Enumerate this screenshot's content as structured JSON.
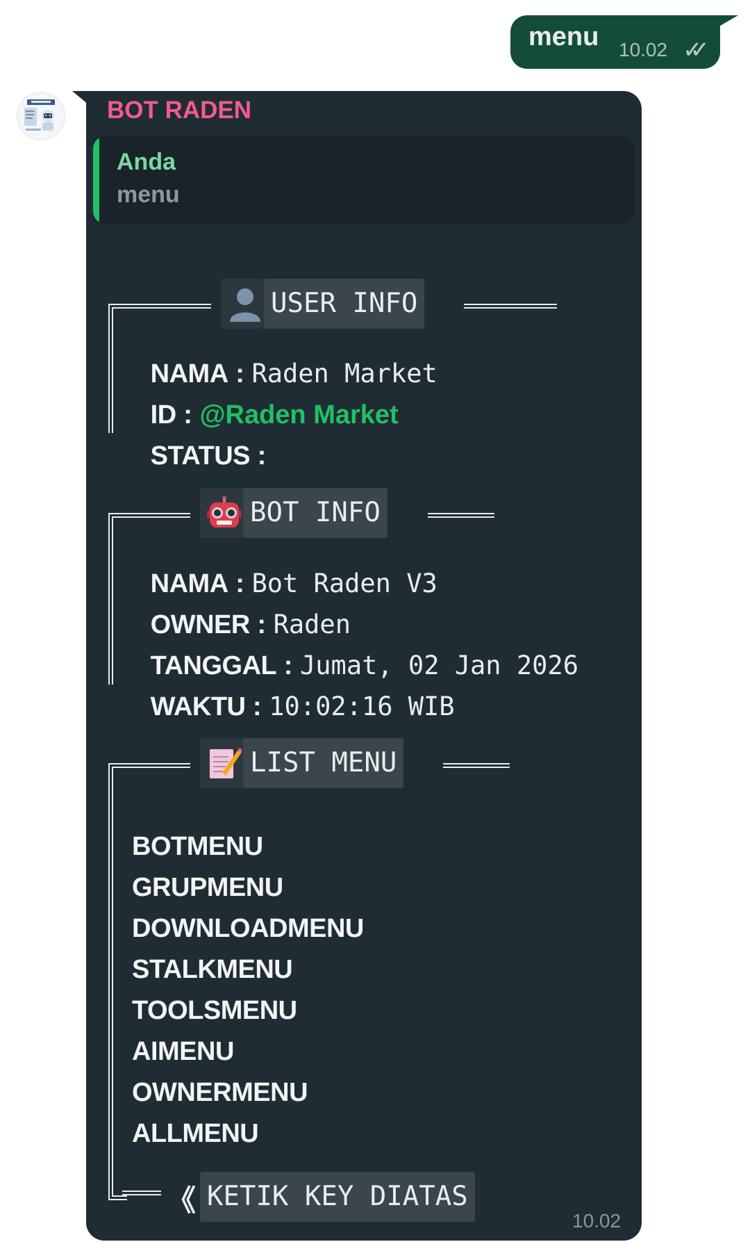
{
  "outgoing": {
    "text": "menu",
    "time": "10.02",
    "status_icon": "double-check-icon"
  },
  "incoming": {
    "sender": "BOT RADEN",
    "time": "10.02",
    "quote": {
      "author": "Anda",
      "text": "menu"
    },
    "user_info": {
      "header": "USER INFO",
      "icon": "user-silhouette-icon",
      "rows": [
        {
          "label": "NAMA",
          "value": "Raden Market"
        },
        {
          "label": "ID",
          "value": "@Raden Market"
        },
        {
          "label": "STATUS",
          "value": ""
        }
      ]
    },
    "bot_info": {
      "header": "BOT INFO",
      "icon": "robot-icon",
      "rows": [
        {
          "label": "NAMA",
          "value": "Bot Raden V3"
        },
        {
          "label": "OWNER",
          "value": "Raden"
        },
        {
          "label": "TANGGAL",
          "value": "Jumat, 02 Jan 2026"
        },
        {
          "label": "WAKTU",
          "value": "10:02:16 WIB"
        }
      ]
    },
    "list_menu": {
      "header": "LIST MENU",
      "icon": "memo-icon",
      "items": [
        "BOTMENU",
        "GRUPMENU",
        "DOWNLOADMENU",
        "STALKMENU",
        "TOOLSMENU",
        "AIMENU",
        "OWNERMENU",
        "ALLMENU"
      ]
    },
    "footer": {
      "arrow": "《",
      "text": "KETIK KEY DIATAS"
    }
  },
  "colors": {
    "outgoing_bubble": "#144d37",
    "incoming_bubble": "#202c33",
    "sender_name": "#f15c8d",
    "quote_bar": "#21c063",
    "mention": "#21c063"
  }
}
